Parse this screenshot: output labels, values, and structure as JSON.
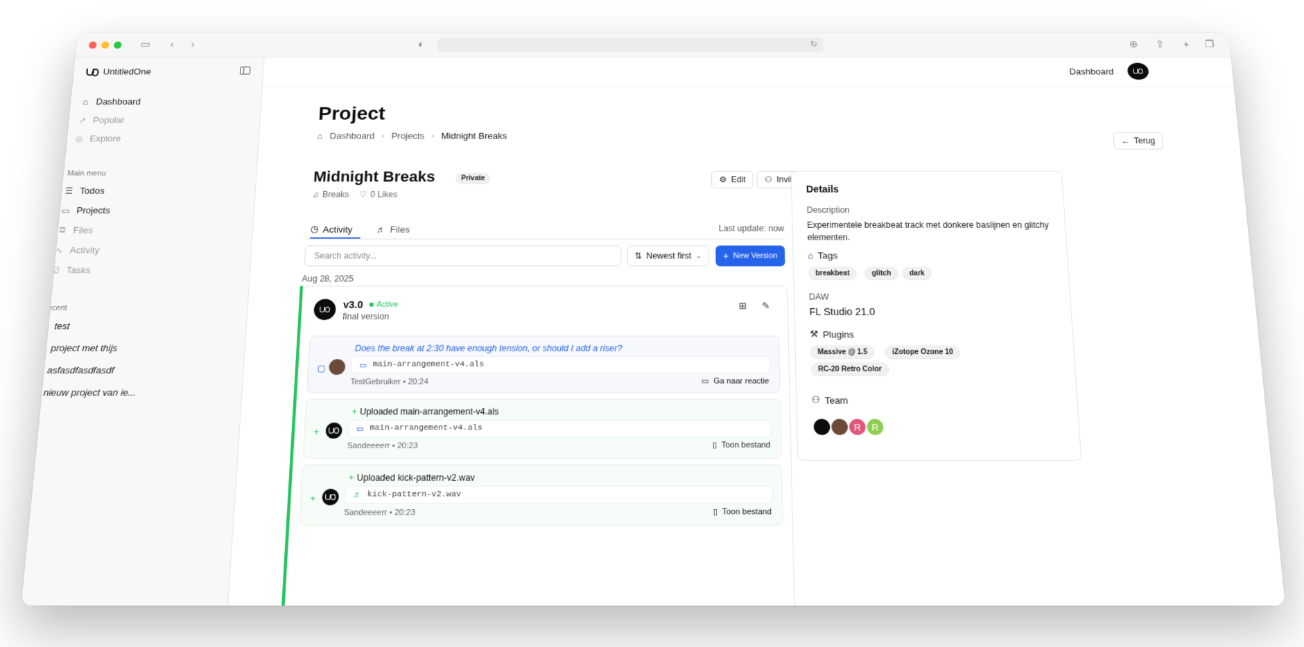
{
  "app": {
    "name": "UntitledOne"
  },
  "sidebar": {
    "top": [
      {
        "label": "Dashboard",
        "icon": "home-icon",
        "muted": false
      },
      {
        "label": "Popular",
        "icon": "trending-icon",
        "muted": true
      },
      {
        "label": "Explore",
        "icon": "compass-icon",
        "muted": true
      }
    ],
    "main_menu_title": "Main menu",
    "main_menu": [
      {
        "label": "Todos",
        "icon": "list-check-icon",
        "muted": false
      },
      {
        "label": "Projects",
        "icon": "folder-icon",
        "muted": false
      },
      {
        "label": "Files",
        "icon": "files-icon",
        "muted": true
      },
      {
        "label": "Activity",
        "icon": "activity-icon",
        "muted": true
      },
      {
        "label": "Tasks",
        "icon": "task-icon",
        "muted": true
      }
    ],
    "recent_title": "Recent",
    "recent": [
      {
        "label": "test"
      },
      {
        "label": "project met thijs"
      },
      {
        "label": "asfasdfasdfasdf"
      },
      {
        "label": "nieuw project van ie..."
      }
    ]
  },
  "topbar": {
    "dashboard_label": "Dashboard"
  },
  "page": {
    "title": "Project",
    "back_label": "Terug",
    "breadcrumb": [
      "Dashboard",
      "Projects",
      "Midnight Breaks"
    ]
  },
  "project": {
    "name": "Midnight Breaks",
    "visibility": "Private",
    "genre": "Breaks",
    "likes": "0 Likes",
    "edit_label": "Edit",
    "invite_label": "Invite"
  },
  "tabs": [
    {
      "label": "Activity",
      "active": true
    },
    {
      "label": "Files",
      "active": false
    }
  ],
  "last_update": "Last update: now",
  "search": {
    "placeholder": "Search activity..."
  },
  "sort": {
    "label": "Newest first"
  },
  "new_version": {
    "label": "New Version"
  },
  "activity": {
    "date": "Aug 28, 2025",
    "version": {
      "label": "v3.0",
      "status": "Active",
      "subtitle": "final version",
      "entries": [
        {
          "type": "comment",
          "title": "Does the break at 2:30 have enough tension, or should I add a riser?",
          "file": "main-arrangement-v4.als",
          "user": "TestGebruiker",
          "time": "20:24",
          "action": "Ga naar reactie"
        },
        {
          "type": "upload",
          "title": "Uploaded main-arrangement-v4.als",
          "file": "main-arrangement-v4.als",
          "user": "Sandeeeerr",
          "time": "20:23",
          "action": "Toon bestand"
        },
        {
          "type": "upload",
          "title": "Uploaded kick-pattern-v2.wav",
          "file": "kick-pattern-v2.wav",
          "user": "Sandeeeerr",
          "time": "20:23",
          "action": "Toon bestand"
        }
      ]
    }
  },
  "details": {
    "title": "Details",
    "description_label": "Description",
    "description": "Experimentele breakbeat track met donkere baslijnen en glitchy elementen.",
    "tags_label": "Tags",
    "tags": [
      "breakbeat",
      "glitch",
      "dark"
    ],
    "daw_label": "DAW",
    "daw": "FL Studio 21.0",
    "plugins_label": "Plugins",
    "plugins": [
      "Massive @ 1.5",
      "iZotope Ozone 10",
      "RC-20 Retro Color"
    ],
    "team_label": "Team",
    "team": [
      {
        "initial": "",
        "color": "#0c0c0c"
      },
      {
        "initial": "",
        "color": "#6b4a3a"
      },
      {
        "initial": "R",
        "color": "#e0557a"
      },
      {
        "initial": "R",
        "color": "#8fcf4f"
      }
    ]
  },
  "colors": {
    "accent": "#2563eb",
    "active": "#22c55e"
  }
}
